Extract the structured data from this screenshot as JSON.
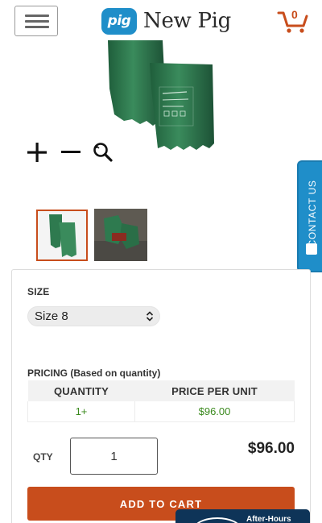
{
  "header": {
    "logo_badge": "pig",
    "logo_text": "New Pig",
    "cart_count": "0",
    "icons": [
      "hamburger-menu-icon",
      "cart-icon"
    ]
  },
  "gallery": {
    "zoom_icons": [
      "plus-icon",
      "minus-icon",
      "magnify-icon"
    ],
    "thumbnails": 2,
    "selected_thumbnail": 1
  },
  "contact_tab": {
    "label": "CONTACT US",
    "icon": "phone-icon"
  },
  "product": {
    "size_label": "SIZE",
    "size_value": "Size 8",
    "pricing_label": "PRICING (Based on quantity)",
    "pricing_table": {
      "headers": [
        "QUANTITY",
        "PRICE PER UNIT"
      ],
      "rows": [
        [
          "1+",
          "$96.00"
        ]
      ]
    },
    "qty_label": "QTY",
    "qty_value": "1",
    "total_price": "$96.00",
    "add_to_cart_label": "ADD TO CART"
  },
  "after_hours": {
    "label": "After-Hours"
  },
  "colors": {
    "brand_blue": "#1f8ec9",
    "accent_orange": "#c84d1c",
    "price_green": "#3b8a1e",
    "glove_green": "#2e7a4f",
    "after_hours_navy": "#0e3458"
  }
}
